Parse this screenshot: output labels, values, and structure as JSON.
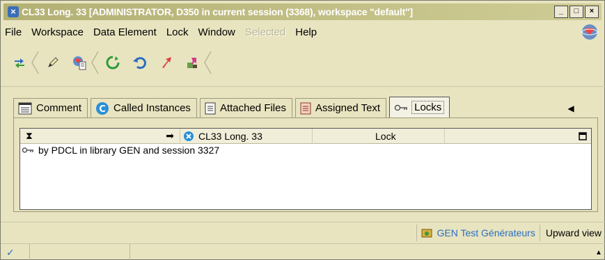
{
  "window": {
    "title": "CL33 Long. 33 [ADMINISTRATOR, D350 in current session (3368), workspace \"default\"]",
    "controls": {
      "minimize": "_",
      "maximize": "□",
      "close": "×"
    }
  },
  "menu": {
    "items": [
      {
        "label": "File",
        "disabled": false
      },
      {
        "label": "Workspace",
        "disabled": false
      },
      {
        "label": "Data Element",
        "disabled": false
      },
      {
        "label": "Lock",
        "disabled": false
      },
      {
        "label": "Window",
        "disabled": false
      },
      {
        "label": "Selected",
        "disabled": true
      },
      {
        "label": "Help",
        "disabled": false
      }
    ]
  },
  "toolbar": {
    "tools": [
      "switch-icon",
      "pencil-icon",
      "document-globe-icon",
      "refresh-icon",
      "undo-icon",
      "arrow-up-icon",
      "transfer-icon"
    ]
  },
  "tabs": [
    {
      "label": "Comment",
      "icon": "comment-icon",
      "active": false
    },
    {
      "label": "Called Instances",
      "icon": "called-instances-icon",
      "active": false
    },
    {
      "label": "Attached Files",
      "icon": "attached-files-icon",
      "active": false
    },
    {
      "label": "Assigned Text",
      "icon": "assigned-text-icon",
      "active": false
    },
    {
      "label": "Locks",
      "icon": "key-icon",
      "active": true
    }
  ],
  "grid": {
    "headers": {
      "instance": "CL33 Long. 33",
      "lock": "Lock"
    },
    "rows": [
      {
        "text": "by PDCL in library GEN and session 3327"
      }
    ]
  },
  "status": {
    "library": "GEN Test Générateurs",
    "view": "Upward view"
  },
  "colors": {
    "background": "#e8e4c0",
    "title_bar": "#b3b074",
    "accent_blue": "#2a6ec0"
  }
}
